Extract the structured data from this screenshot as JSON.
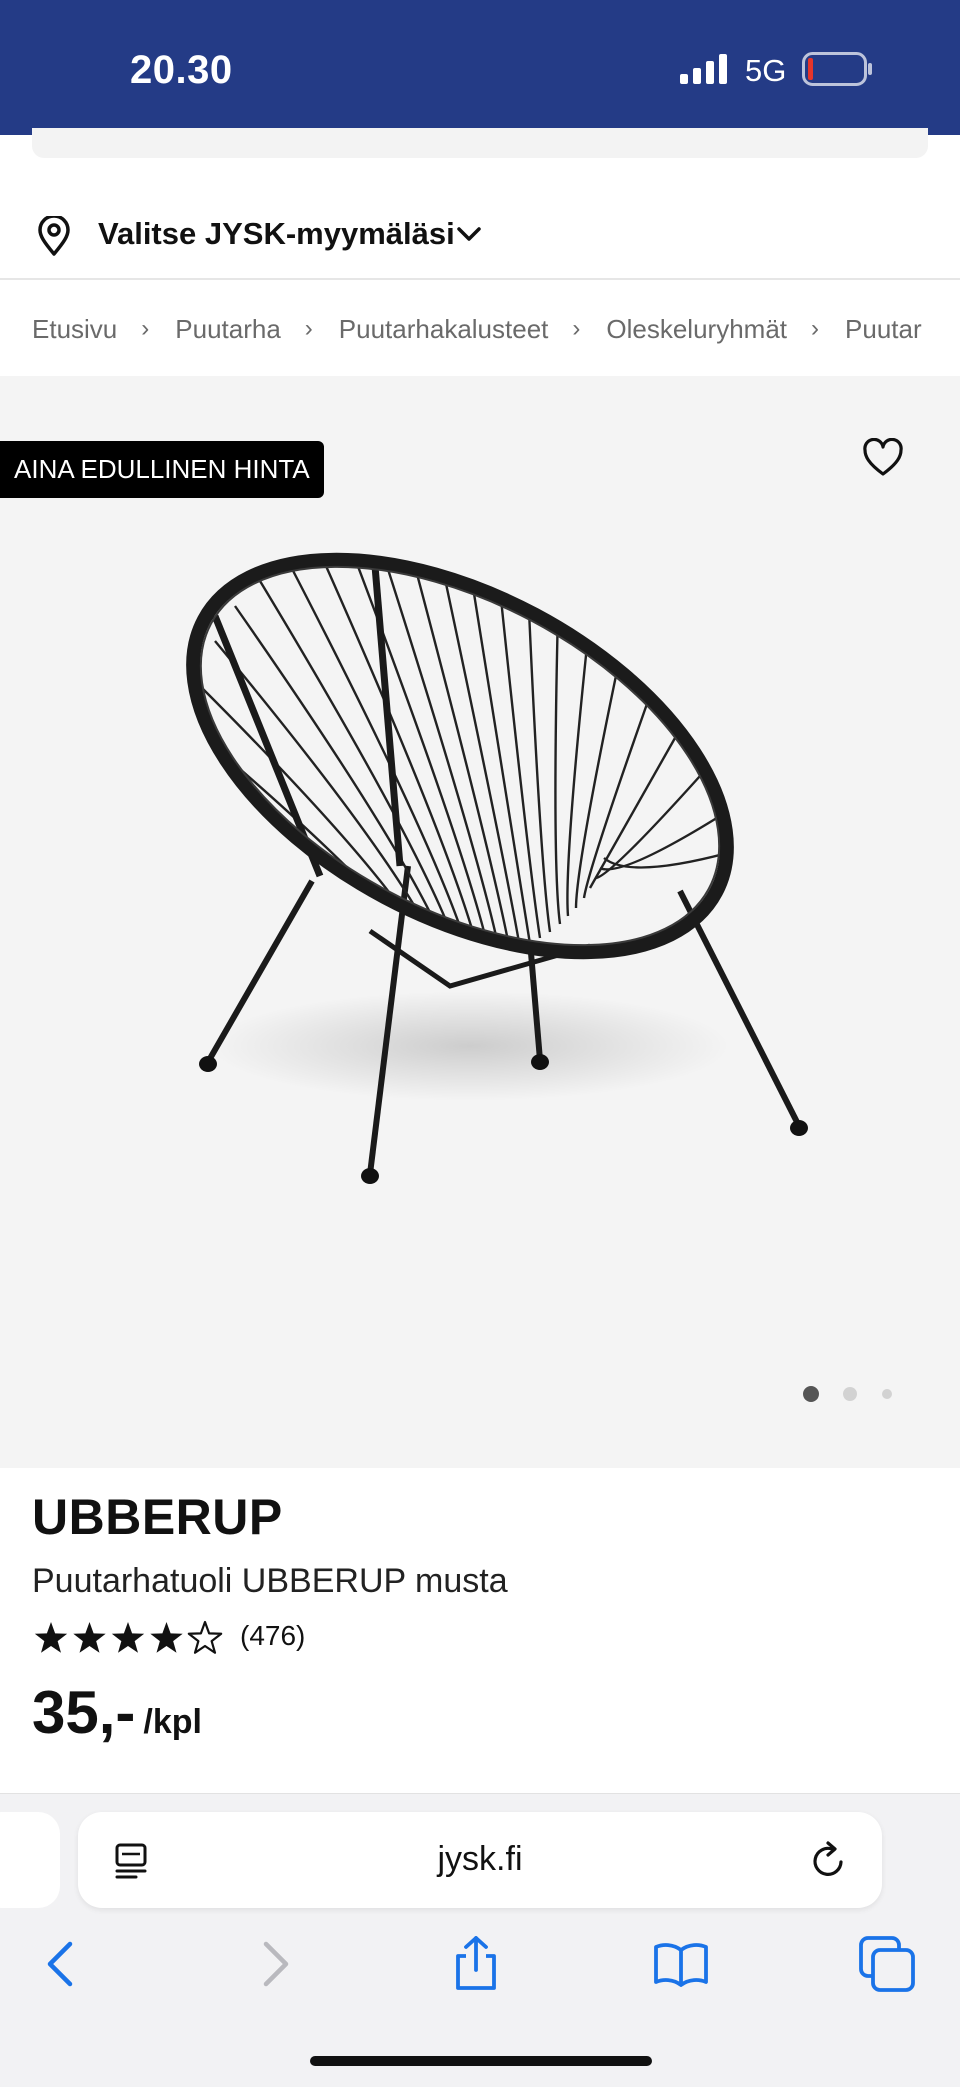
{
  "status_bar": {
    "time": "20.30",
    "network": "5G",
    "background_color": "#243b86",
    "icons": [
      "signal-icon",
      "battery-icon"
    ]
  },
  "store_selector": {
    "label": "Valitse JYSK-myymäläsi",
    "icons": [
      "pin-icon",
      "chevron-down-icon"
    ]
  },
  "breadcrumb": {
    "items": [
      "Etusivu",
      "Puutarha",
      "Puutarhakalusteet",
      "Oleskeluryhmät",
      "Puutar"
    ],
    "separator": "›"
  },
  "product_image": {
    "badge": "AINA EDULLINEN HINTA",
    "carousel": {
      "total": 3,
      "active": 1
    },
    "icons": [
      "heart-icon"
    ]
  },
  "product": {
    "brand": "UBBERUP",
    "name": "Puutarhatuoli UBBERUP musta",
    "rating": {
      "stars": 4,
      "max": 5,
      "count_label": "(476)"
    },
    "price": "35,-",
    "unit": "/kpl"
  },
  "browser": {
    "url": "jysk.fi",
    "toolbar_icons": [
      "back-icon",
      "forward-icon",
      "share-icon",
      "bookmarks-icon",
      "tabs-icon"
    ],
    "accent_color": "#1a73e8"
  }
}
